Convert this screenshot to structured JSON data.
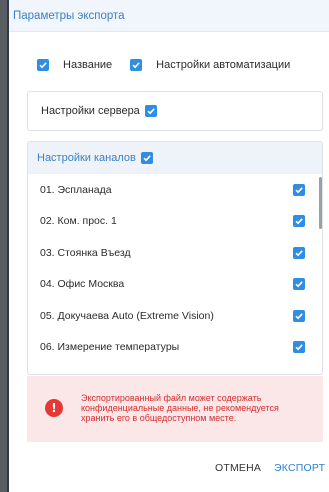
{
  "dialog": {
    "title": "Параметры экспорта"
  },
  "options": {
    "name_label": "Название",
    "name_checked": true,
    "automation_label": "Настройки автоматизации",
    "automation_checked": true
  },
  "server": {
    "label": "Настройки сервера",
    "checked": true
  },
  "channels": {
    "header": "Настройки каналов",
    "header_checked": true,
    "items": [
      {
        "label": "01. Эспланада",
        "checked": true
      },
      {
        "label": "02. Ком. прос. 1",
        "checked": true
      },
      {
        "label": "03. Стоянка Въезд",
        "checked": true
      },
      {
        "label": "04. Офис Москва",
        "checked": true
      },
      {
        "label": "05. Докучаева Auto (Extreme Vision)",
        "checked": true
      },
      {
        "label": "06. Измерение температуры",
        "checked": true
      }
    ]
  },
  "warning": {
    "icon": "alert-circle-icon",
    "text": "Экспортированный файл может содержать конфиденциальные данные, не рекомендуется хранить его в общедоступном месте."
  },
  "buttons": {
    "cancel": "ОТМЕНА",
    "export": "ЭКСПОРТ"
  },
  "colors": {
    "accent": "#2f8de4",
    "warning_bg": "#fbe7e7",
    "warning_text": "#d32f2f"
  }
}
